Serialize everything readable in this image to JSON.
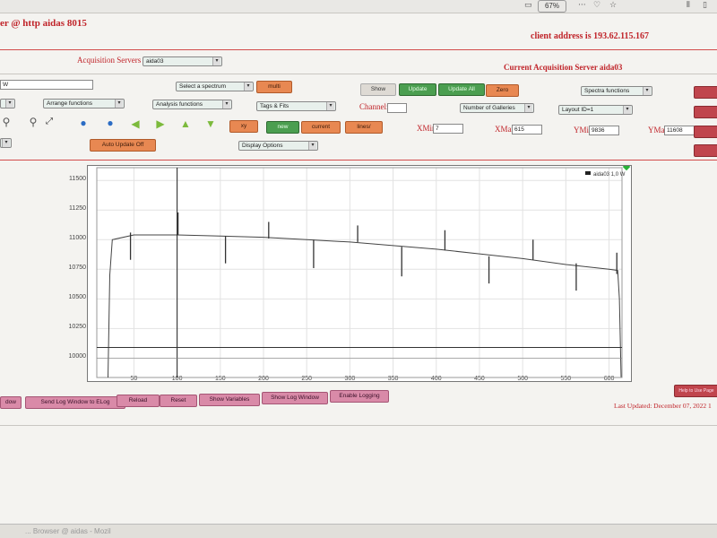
{
  "browser": {
    "zoom": "67%",
    "tab_icons": [
      "document-icon",
      "more-icon",
      "pocket-icon",
      "star-icon",
      "library-icon",
      "sidebar-icon"
    ]
  },
  "header": {
    "title": "er @ http aidas 8015",
    "client_address": "client address is 193.62.115.167"
  },
  "acq": {
    "servers_label": "Acquisition Servers",
    "server_selected": "aida03",
    "current_label": "Current Acquisition Server aida03"
  },
  "controls": {
    "left_input": "W",
    "select_spectrum": "Select a spectrum",
    "multi": "multi",
    "show": "Show",
    "update": "Update",
    "update_all": "Update All",
    "zero": "Zero",
    "spectra_functions": "Spectra functions",
    "arrange_functions": "Arrange functions",
    "analysis_functions": "Analysis functions",
    "tags_fits": "Tags & Fits",
    "channel_label": "Channel:",
    "channel_value": "",
    "number_of_galleries": "Number of Galleries",
    "layout": "Layout ID=1",
    "xy": "xy",
    "new": "new",
    "current": "current",
    "lines": "lines/",
    "xmin_label": "XMin",
    "xmin_value": "7",
    "xmax_label": "XMax",
    "xmax_value": "615",
    "ymin_label": "YMin",
    "ymin_value": "9836",
    "ymax_label": "YMax",
    "ymax_value": "11608",
    "auto_update": "Auto Update Off",
    "display_options": "Display Options"
  },
  "bottom": {
    "buttons": [
      "dow",
      "Send Log Window to ELog",
      "Reload",
      "Reset",
      "Show Variables",
      "Show Log Window",
      "Enable Logging"
    ],
    "last_updated": "Last Updated: December 07, 2022 1",
    "right_button": "Help to Use Page"
  },
  "taskbar": {
    "text": "... Browser @ aidas - Mozil"
  },
  "chart_data": {
    "type": "line",
    "series": [
      {
        "name": "aida03 1,0 W"
      }
    ],
    "xlim": [
      7,
      615
    ],
    "ylim": [
      9836,
      11608
    ],
    "x_ticks": [
      50,
      100,
      150,
      200,
      250,
      300,
      350,
      400,
      450,
      500,
      550,
      600
    ],
    "y_ticks": [
      10000,
      10250,
      10500,
      10750,
      11000,
      11250,
      11500
    ],
    "baseline": [
      [
        20,
        9836
      ],
      [
        22,
        10700
      ],
      [
        25,
        11000
      ],
      [
        50,
        11040
      ],
      [
        100,
        11040
      ],
      [
        150,
        11030
      ],
      [
        200,
        11020
      ],
      [
        250,
        11000
      ],
      [
        300,
        10980
      ],
      [
        350,
        10950
      ],
      [
        400,
        10920
      ],
      [
        450,
        10880
      ],
      [
        500,
        10840
      ],
      [
        550,
        10790
      ],
      [
        600,
        10750
      ],
      [
        610,
        10740
      ],
      [
        612,
        10500
      ],
      [
        614,
        9840
      ]
    ],
    "spikes": [
      {
        "x": 46,
        "low": 10830,
        "high": 11060
      },
      {
        "x": 101,
        "low": 11040,
        "high": 11230
      },
      {
        "x": 156,
        "low": 10800,
        "high": 11030
      },
      {
        "x": 206,
        "low": 11010,
        "high": 11150
      },
      {
        "x": 258,
        "low": 10760,
        "high": 11000
      },
      {
        "x": 309,
        "low": 10980,
        "high": 11120
      },
      {
        "x": 360,
        "low": 10690,
        "high": 10940
      },
      {
        "x": 410,
        "low": 10910,
        "high": 11080
      },
      {
        "x": 461,
        "low": 10630,
        "high": 10860
      },
      {
        "x": 512,
        "low": 10830,
        "high": 11000
      },
      {
        "x": 562,
        "low": 10570,
        "high": 10800
      },
      {
        "x": 609,
        "low": 10710,
        "high": 10890
      }
    ],
    "cursor_x": 100,
    "cursor_y": 10090
  }
}
